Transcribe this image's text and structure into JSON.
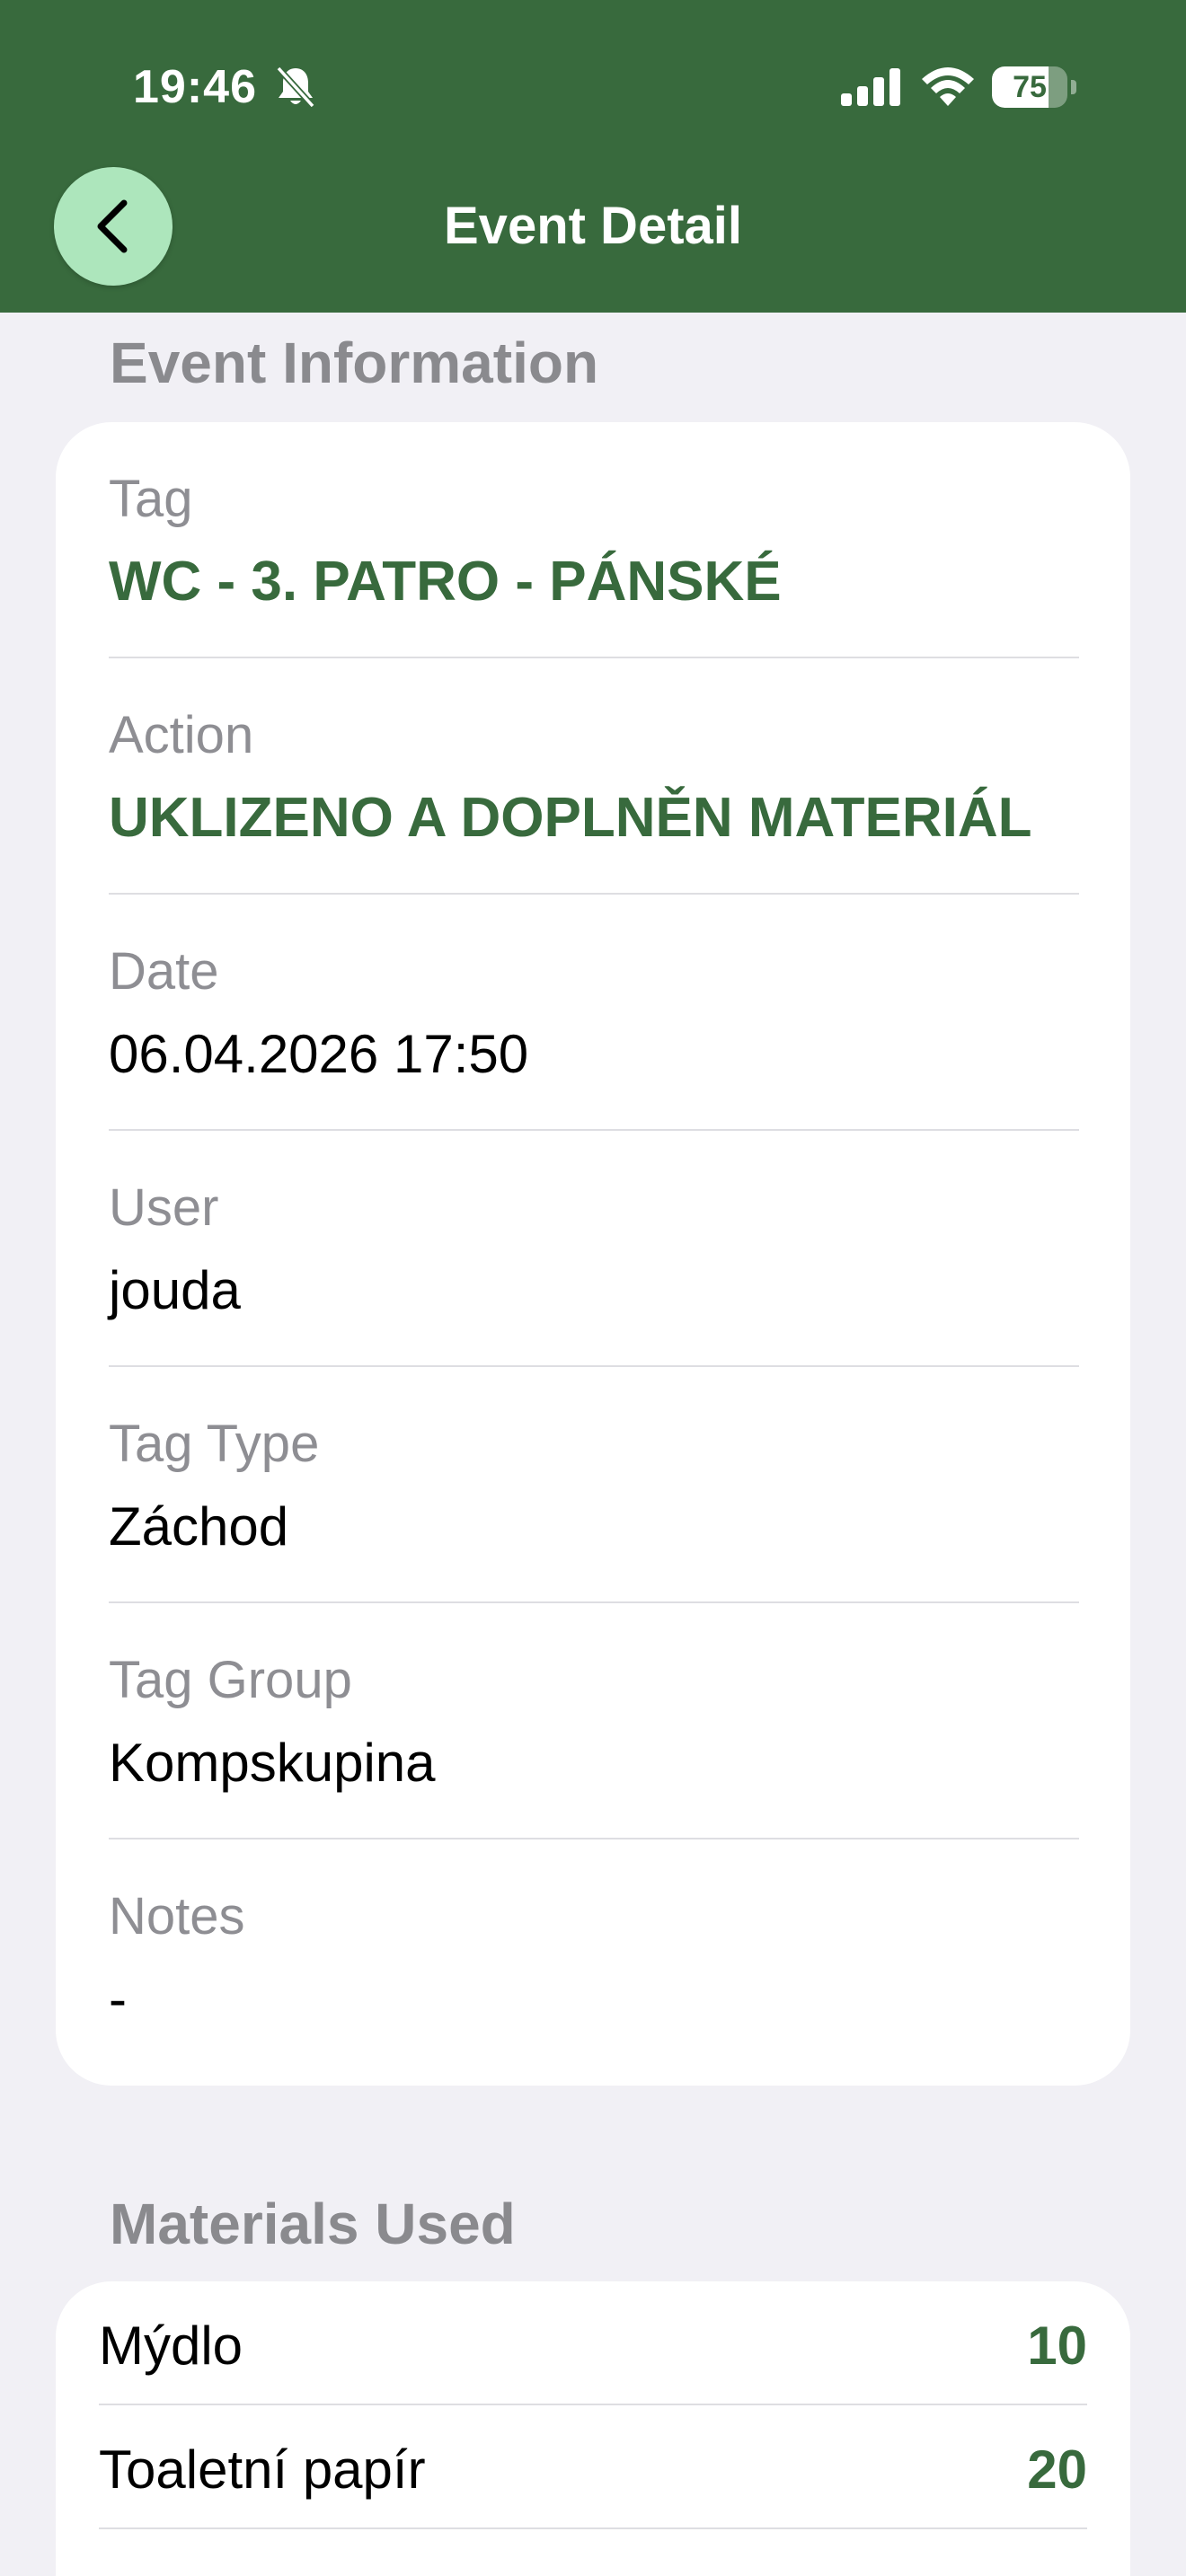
{
  "status_bar": {
    "time": "19:46",
    "battery_level": "75",
    "silent_icon": "bell-slash-icon",
    "signal_icon": "cellular-signal-icon",
    "wifi_icon": "wifi-icon"
  },
  "nav": {
    "title": "Event Detail",
    "back_icon": "chevron-left-icon"
  },
  "event_information": {
    "header": "Event Information",
    "fields": [
      {
        "label": "Tag",
        "value": "WC - 3. PATRO - PÁNSKÉ"
      },
      {
        "label": "Action",
        "value": "UKLIZENO A DOPLNĚN MATERIÁL"
      },
      {
        "label": "Date",
        "value": "06.04.2026 17:50"
      },
      {
        "label": "User",
        "value": "jouda"
      },
      {
        "label": "Tag Type",
        "value": "Záchod"
      },
      {
        "label": "Tag Group",
        "value": "Kompskupina"
      },
      {
        "label": "Notes",
        "value": "-"
      }
    ]
  },
  "materials": {
    "header": "Materials Used",
    "items": [
      {
        "name": "Mýdlo",
        "quantity": "10"
      },
      {
        "name": "Toaletní papír",
        "quantity": "20"
      }
    ]
  },
  "colors": {
    "header_green": "#386A3D",
    "accent_green": "#386A3D",
    "back_button_bg": "#ADE6BC",
    "background": "#F1F0F5",
    "label_gray": "#8E8E93"
  }
}
